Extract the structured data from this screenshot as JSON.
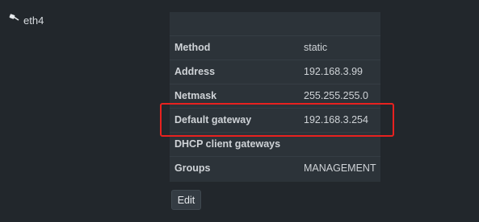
{
  "interface": {
    "icon": "network-cable-icon",
    "name": "eth4"
  },
  "details": [
    {
      "key": "Method",
      "value": "static"
    },
    {
      "key": "Address",
      "value": "192.168.3.99"
    },
    {
      "key": "Netmask",
      "value": "255.255.255.0"
    },
    {
      "key": "Default gateway",
      "value": "192.168.3.254"
    },
    {
      "key": "DHCP client gateways",
      "value": ""
    },
    {
      "key": "Groups",
      "value": "MANAGEMENT"
    }
  ],
  "actions": {
    "edit_label": "Edit"
  },
  "colors": {
    "background": "#22272c",
    "panel": "#2c3339",
    "highlight": "#e8211f"
  }
}
